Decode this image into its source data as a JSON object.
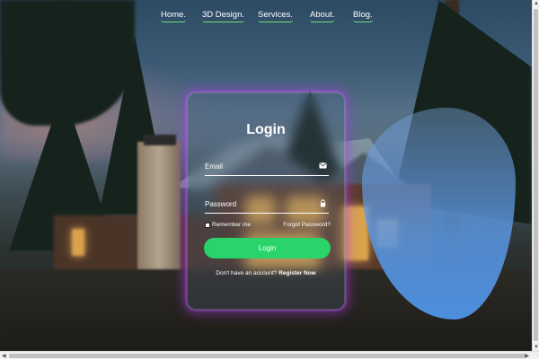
{
  "nav": {
    "items": [
      {
        "label": "Home."
      },
      {
        "label": "3D Design."
      },
      {
        "label": "Services."
      },
      {
        "label": "About."
      },
      {
        "label": "Blog."
      }
    ]
  },
  "login": {
    "title": "Login",
    "email_placeholder": "Email",
    "email_value": "",
    "email_icon": "envelope-icon",
    "password_placeholder": "Password",
    "password_value": "",
    "password_icon": "lock-icon",
    "remember_label": "Remember me",
    "forgot_label": "Forgot Password?",
    "button_label": "Login",
    "register_prompt": "Don't have an account?",
    "register_link": "Register Now"
  },
  "colors": {
    "accent_green": "#2bd36b",
    "nav_underline": "#6fe07a",
    "card_glow": "#aa3ce6",
    "blob_blue": "#4d8fde"
  }
}
